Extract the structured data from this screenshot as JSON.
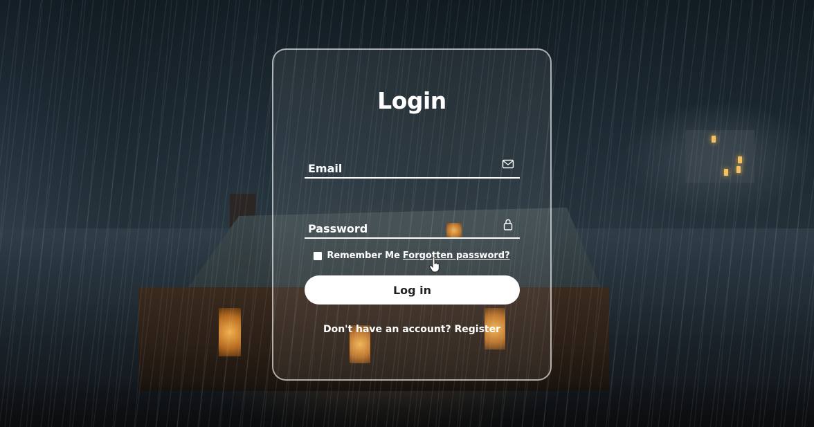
{
  "login_form": {
    "title": "Login",
    "email_placeholder": "Email",
    "email_icon": "mail-icon",
    "password_placeholder": "Password",
    "password_icon": "lock-icon",
    "remember_label": "Remember Me",
    "remember_checked": false,
    "forgot_link": "Forgotten password?",
    "login_button": "Log in",
    "register_prompt": "Don't have an account?",
    "register_link": "Register"
  },
  "colors": {
    "card_border": "#ffffffa0",
    "text": "#ffffff",
    "button_bg": "#ffffff",
    "button_text": "#222222"
  }
}
